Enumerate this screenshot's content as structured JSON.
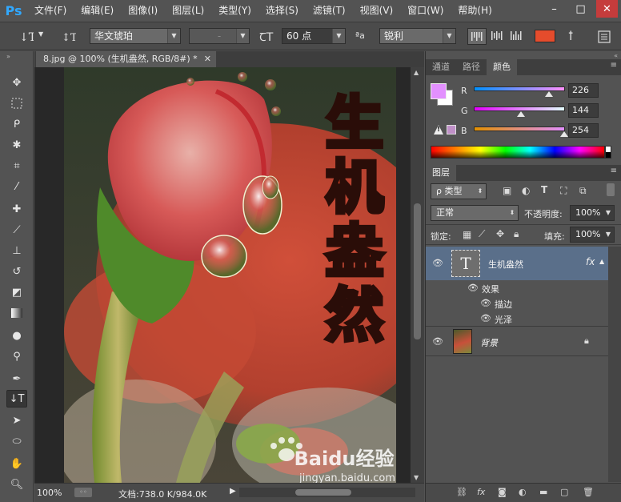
{
  "app": {
    "logo": "Ps"
  },
  "menu": [
    "文件(F)",
    "编辑(E)",
    "图像(I)",
    "图层(L)",
    "类型(Y)",
    "选择(S)",
    "滤镜(T)",
    "视图(V)",
    "窗口(W)",
    "帮助(H)"
  ],
  "window_controls": [
    "–",
    "□",
    "✕"
  ],
  "options": {
    "tool_icon": "vertical-type-tool-icon",
    "font_family": "华文琥珀",
    "font_style": "-",
    "font_size": "60 点",
    "aa_label": "ªa",
    "antialias": "锐利",
    "text_color": "#e54c2c"
  },
  "document": {
    "tab_title": "8.jpg @ 100% (生机盎然, RGB/8#) *",
    "canvas_text": [
      "生",
      "机",
      "盎",
      "然"
    ],
    "zoom": "100%",
    "doc_info": "文档:738.0 K/984.0K"
  },
  "color_panel": {
    "tabs": [
      "通道",
      "路径",
      "颜色"
    ],
    "active_tab": "颜色",
    "foreground": "#e290fe",
    "channels": [
      {
        "label": "R",
        "value": "226",
        "fraction": 0.886
      },
      {
        "label": "G",
        "value": "144",
        "fraction": 0.565
      },
      {
        "label": "B",
        "value": "254",
        "fraction": 0.996
      }
    ],
    "warning_icon": "!"
  },
  "layers_panel": {
    "tab": "图层",
    "filter_kind": "ρ 类型",
    "blend_mode": "正常",
    "opacity_label": "不透明度:",
    "opacity": "100%",
    "lock_label": "锁定:",
    "fill_label": "填充:",
    "fill": "100%",
    "text_layer_name": "生机盎然",
    "effects_label": "效果",
    "effects": [
      "描边",
      "光泽"
    ],
    "background_layer_name": "背景",
    "fx": "fx",
    "thumb_letter": "T"
  },
  "watermark": {
    "brand": "Baidu经验",
    "url": "jingyan.baidu.com"
  }
}
